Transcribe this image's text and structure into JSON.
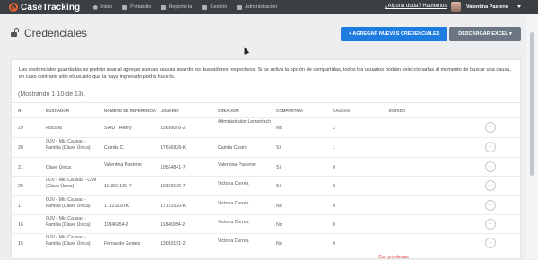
{
  "app": {
    "logo_text": "CaseTracking",
    "nav": [
      {
        "label": "Inicio",
        "icon": "home-icon"
      },
      {
        "label": "Portafolio",
        "icon": "briefcase-icon"
      },
      {
        "label": "Reportería",
        "icon": "report-icon"
      },
      {
        "label": "Gestión",
        "icon": "folder-icon"
      },
      {
        "label": "Administración",
        "icon": "gear-icon"
      }
    ],
    "help_link": "¿Alguna duda? Hablemos",
    "user_name": "Valentina Pastene"
  },
  "page": {
    "title": "Credenciales",
    "add_button": "+ AGREGAR NUEVAS CREDENCIALES",
    "download_button": "DESCARGAR EXCEL ▾",
    "info_text": "Las credenciales guardadas se podrán usar al agregar nuevas causas usando los buscadores respectivos. Si se activa la opción de compartirlas, todos los usuarios podrán seleccionarlas al momento de buscar una causa, en caso contrario sólo el usuario que la haya ingresado podrá hacerlo.",
    "showing": "(Mostrando 1-10 de 13)."
  },
  "table": {
    "headers": [
      "N°",
      "BUSCADOR",
      "NOMBRE DE REFERENCIA",
      "USUARIO",
      "CREADOR",
      "COMPARTIDA",
      "CAUSAS",
      "ESTADO"
    ],
    "rows": [
      {
        "n": "29",
        "buscador": "Fiscalía",
        "referencia": "SIAU - Henry",
        "usuario": "15639006-2",
        "creador": "Administrador Lemontech",
        "compartida": "No",
        "causas": "2",
        "estado": ""
      },
      {
        "n": "28",
        "buscador": "OJV - Mis Causas - Familia (Clave Única)",
        "referencia": "Camila C.",
        "usuario": "17656928-K",
        "creador": "Camila Castro",
        "compartida": "Sí",
        "causas": "1",
        "estado": ""
      },
      {
        "n": "21",
        "buscador": "Clave Única",
        "referencia": "Valentina Pastene",
        "usuario": "19564841-7",
        "creador": "Valentina Pastene",
        "compartida": "Sí",
        "causas": "0",
        "estado": ""
      },
      {
        "n": "20",
        "buscador": "OJV - Mis Causas - Civil (Clave Única)",
        "referencia": "19.393.136-7",
        "usuario": "19393136-7",
        "creador": "Victoria Correa",
        "compartida": "Sí",
        "causas": "0",
        "estado": ""
      },
      {
        "n": "17",
        "buscador": "OJV - Mis Causas - Familia (Clave Única)",
        "referencia": "17121520-K",
        "usuario": "17121520-K",
        "creador": "Victoria Correa",
        "compartida": "No",
        "causas": "0",
        "estado": ""
      },
      {
        "n": "16",
        "buscador": "OJV - Mis Causas - Familia (Clave Única)",
        "referencia": "11846954-2",
        "usuario": "11846954-2",
        "creador": "Victoria Correa",
        "compartida": "No",
        "causas": "0",
        "estado": ""
      },
      {
        "n": "15",
        "buscador": "OJV - Mis Causas - Familia (Clave Única)",
        "referencia": "Fernando Gomez",
        "usuario": "13033191-2",
        "creador": "Victoria Correa",
        "compartida": "No",
        "causas": "0",
        "estado": ""
      }
    ],
    "action_symbol": "···",
    "partial_status": "Con problemas"
  },
  "colors": {
    "topbar": "#3a3f44",
    "primary": "#1e7be0",
    "secondary": "#6b7682",
    "logo_accent": "#e8622c"
  }
}
